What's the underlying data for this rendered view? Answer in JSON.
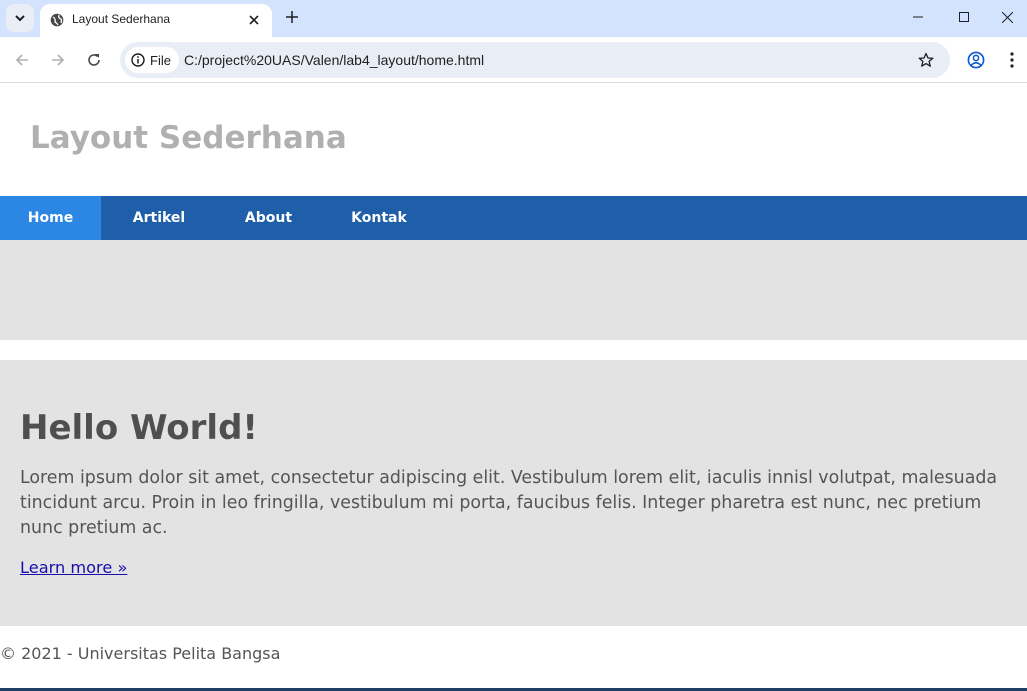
{
  "browser": {
    "tab_title": "Layout Sederhana",
    "site_info_label": "File",
    "url": "C:/project%20UAS/Valen/lab4_layout/home.html",
    "icons": [
      "tab-search-icon",
      "globe-icon",
      "close-icon",
      "plus-icon",
      "minimize-icon",
      "maximize-icon",
      "close-window-icon",
      "back-arrow-icon",
      "forward-arrow-icon",
      "reload-icon",
      "info-icon",
      "star-icon",
      "profile-icon",
      "more-vert-icon"
    ]
  },
  "site": {
    "title": "Layout Sederhana",
    "nav": [
      {
        "label": "Home",
        "active": true
      },
      {
        "label": "Artikel",
        "active": false
      },
      {
        "label": "About",
        "active": false
      },
      {
        "label": "Kontak",
        "active": false
      }
    ],
    "main": {
      "heading": "Hello World!",
      "text": "Lorem ipsum dolor sit amet, consectetur adipiscing elit. Vestibulum lorem elit, iaculis innisl volutpat, malesuada tincidunt arcu. Proin in leo fringilla, vestibulum mi porta, faucibus felis. Integer pharetra est nunc, nec pretium nunc pretium ac.",
      "link": "Learn more »"
    },
    "footer": "© 2021 - Universitas Pelita Bangsa"
  },
  "colors": {
    "tabstrip": "#d3e3fd",
    "nav_bg": "#1f5fa9",
    "nav_active": "#2b86e4",
    "panel_bg": "#e3e3e3",
    "title_text": "#b0b0b0",
    "heading_text": "#4f4f4f",
    "link": "#1a0dab"
  }
}
